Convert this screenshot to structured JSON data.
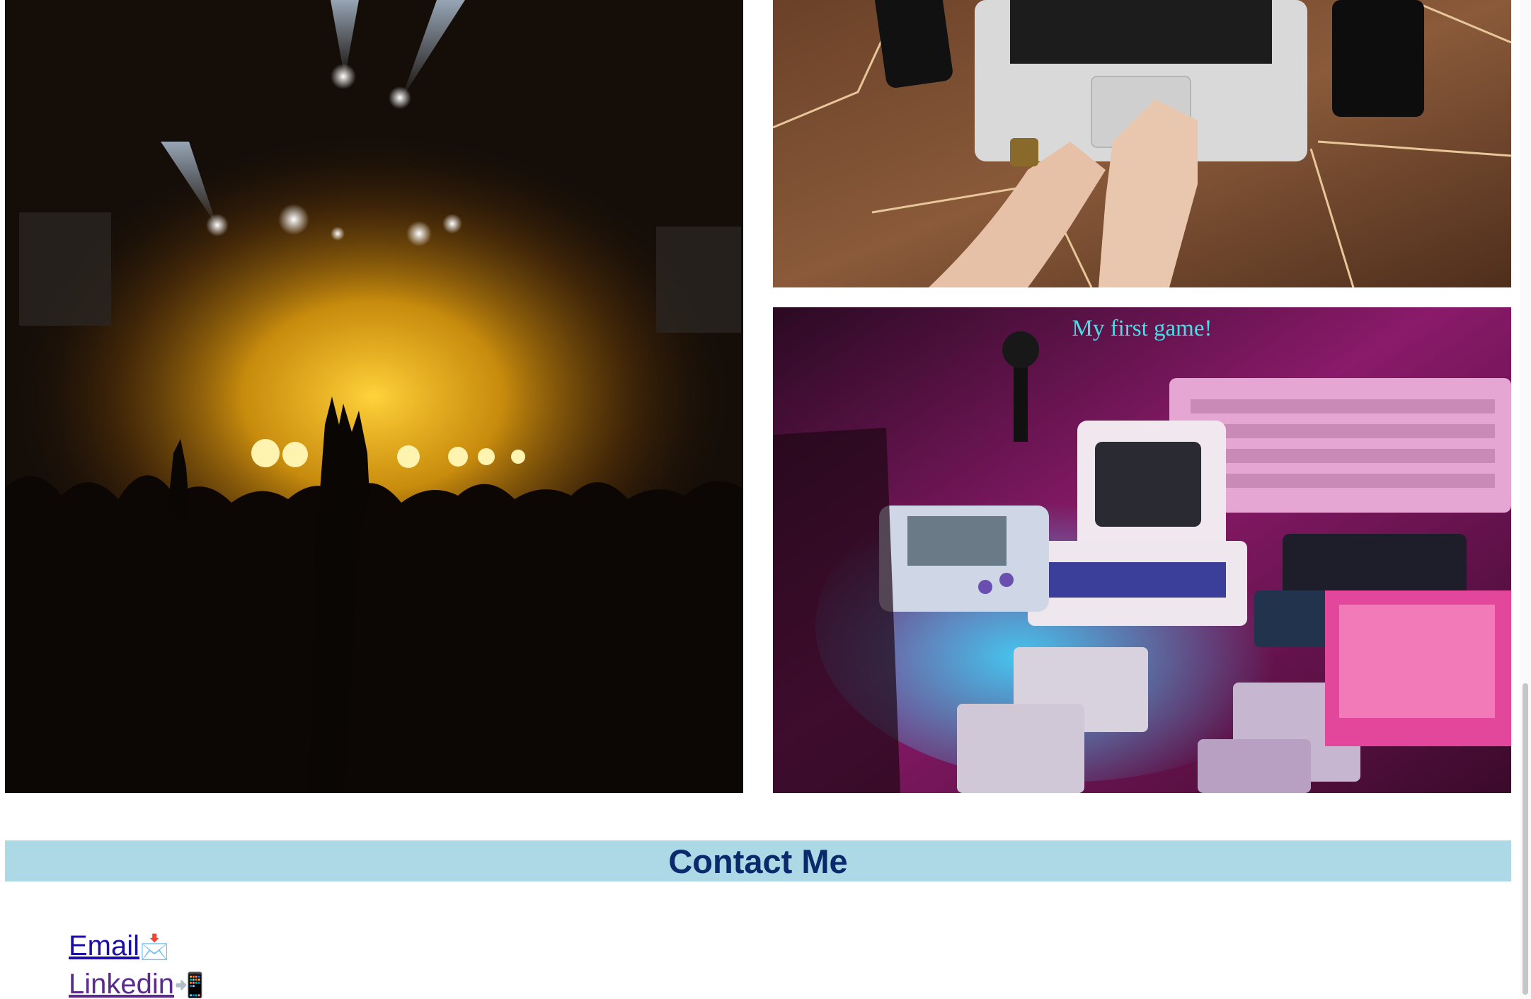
{
  "gallery": {
    "concert_photo": {
      "icon": "concert-crowd-photo"
    },
    "laptop_photo": {
      "icon": "laptop-typing-photo"
    },
    "retro_photo": {
      "icon": "retro-computers-photo",
      "caption": "My first game!"
    }
  },
  "contact": {
    "heading": "Contact Me",
    "links": [
      {
        "label": "Email",
        "emoji": "📩",
        "icon": "envelope-icon"
      },
      {
        "label": "Linkedin",
        "emoji": "📲",
        "icon": "phone-arrow-icon"
      }
    ]
  },
  "colors": {
    "banner_bg": "#add8e6",
    "heading": "#0a2a6b",
    "caption": "#44e0e8",
    "link": "#1a0dab",
    "visited_link": "#5a2b8c"
  }
}
